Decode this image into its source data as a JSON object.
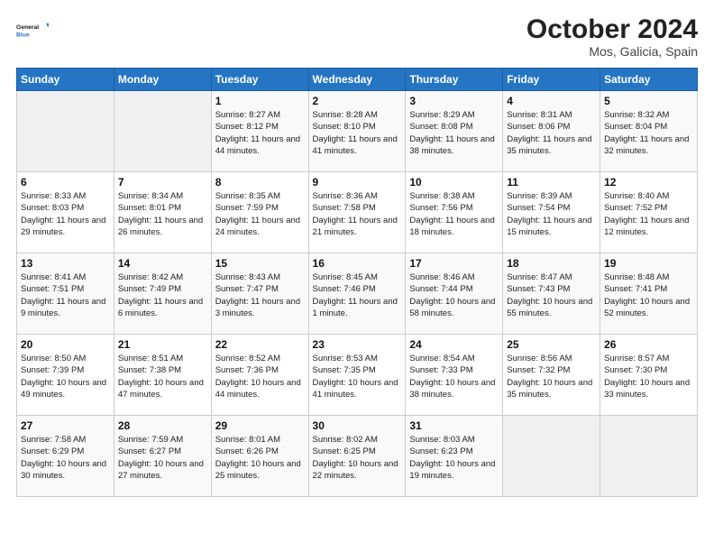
{
  "logo": {
    "line1": "General",
    "line2": "Blue"
  },
  "title": "October 2024",
  "subtitle": "Mos, Galicia, Spain",
  "days_of_week": [
    "Sunday",
    "Monday",
    "Tuesday",
    "Wednesday",
    "Thursday",
    "Friday",
    "Saturday"
  ],
  "weeks": [
    [
      {
        "num": "",
        "info": ""
      },
      {
        "num": "",
        "info": ""
      },
      {
        "num": "1",
        "info": "Sunrise: 8:27 AM\nSunset: 8:12 PM\nDaylight: 11 hours and 44 minutes."
      },
      {
        "num": "2",
        "info": "Sunrise: 8:28 AM\nSunset: 8:10 PM\nDaylight: 11 hours and 41 minutes."
      },
      {
        "num": "3",
        "info": "Sunrise: 8:29 AM\nSunset: 8:08 PM\nDaylight: 11 hours and 38 minutes."
      },
      {
        "num": "4",
        "info": "Sunrise: 8:31 AM\nSunset: 8:06 PM\nDaylight: 11 hours and 35 minutes."
      },
      {
        "num": "5",
        "info": "Sunrise: 8:32 AM\nSunset: 8:04 PM\nDaylight: 11 hours and 32 minutes."
      }
    ],
    [
      {
        "num": "6",
        "info": "Sunrise: 8:33 AM\nSunset: 8:03 PM\nDaylight: 11 hours and 29 minutes."
      },
      {
        "num": "7",
        "info": "Sunrise: 8:34 AM\nSunset: 8:01 PM\nDaylight: 11 hours and 26 minutes."
      },
      {
        "num": "8",
        "info": "Sunrise: 8:35 AM\nSunset: 7:59 PM\nDaylight: 11 hours and 24 minutes."
      },
      {
        "num": "9",
        "info": "Sunrise: 8:36 AM\nSunset: 7:58 PM\nDaylight: 11 hours and 21 minutes."
      },
      {
        "num": "10",
        "info": "Sunrise: 8:38 AM\nSunset: 7:56 PM\nDaylight: 11 hours and 18 minutes."
      },
      {
        "num": "11",
        "info": "Sunrise: 8:39 AM\nSunset: 7:54 PM\nDaylight: 11 hours and 15 minutes."
      },
      {
        "num": "12",
        "info": "Sunrise: 8:40 AM\nSunset: 7:52 PM\nDaylight: 11 hours and 12 minutes."
      }
    ],
    [
      {
        "num": "13",
        "info": "Sunrise: 8:41 AM\nSunset: 7:51 PM\nDaylight: 11 hours and 9 minutes."
      },
      {
        "num": "14",
        "info": "Sunrise: 8:42 AM\nSunset: 7:49 PM\nDaylight: 11 hours and 6 minutes."
      },
      {
        "num": "15",
        "info": "Sunrise: 8:43 AM\nSunset: 7:47 PM\nDaylight: 11 hours and 3 minutes."
      },
      {
        "num": "16",
        "info": "Sunrise: 8:45 AM\nSunset: 7:46 PM\nDaylight: 11 hours and 1 minute."
      },
      {
        "num": "17",
        "info": "Sunrise: 8:46 AM\nSunset: 7:44 PM\nDaylight: 10 hours and 58 minutes."
      },
      {
        "num": "18",
        "info": "Sunrise: 8:47 AM\nSunset: 7:43 PM\nDaylight: 10 hours and 55 minutes."
      },
      {
        "num": "19",
        "info": "Sunrise: 8:48 AM\nSunset: 7:41 PM\nDaylight: 10 hours and 52 minutes."
      }
    ],
    [
      {
        "num": "20",
        "info": "Sunrise: 8:50 AM\nSunset: 7:39 PM\nDaylight: 10 hours and 49 minutes."
      },
      {
        "num": "21",
        "info": "Sunrise: 8:51 AM\nSunset: 7:38 PM\nDaylight: 10 hours and 47 minutes."
      },
      {
        "num": "22",
        "info": "Sunrise: 8:52 AM\nSunset: 7:36 PM\nDaylight: 10 hours and 44 minutes."
      },
      {
        "num": "23",
        "info": "Sunrise: 8:53 AM\nSunset: 7:35 PM\nDaylight: 10 hours and 41 minutes."
      },
      {
        "num": "24",
        "info": "Sunrise: 8:54 AM\nSunset: 7:33 PM\nDaylight: 10 hours and 38 minutes."
      },
      {
        "num": "25",
        "info": "Sunrise: 8:56 AM\nSunset: 7:32 PM\nDaylight: 10 hours and 35 minutes."
      },
      {
        "num": "26",
        "info": "Sunrise: 8:57 AM\nSunset: 7:30 PM\nDaylight: 10 hours and 33 minutes."
      }
    ],
    [
      {
        "num": "27",
        "info": "Sunrise: 7:58 AM\nSunset: 6:29 PM\nDaylight: 10 hours and 30 minutes."
      },
      {
        "num": "28",
        "info": "Sunrise: 7:59 AM\nSunset: 6:27 PM\nDaylight: 10 hours and 27 minutes."
      },
      {
        "num": "29",
        "info": "Sunrise: 8:01 AM\nSunset: 6:26 PM\nDaylight: 10 hours and 25 minutes."
      },
      {
        "num": "30",
        "info": "Sunrise: 8:02 AM\nSunset: 6:25 PM\nDaylight: 10 hours and 22 minutes."
      },
      {
        "num": "31",
        "info": "Sunrise: 8:03 AM\nSunset: 6:23 PM\nDaylight: 10 hours and 19 minutes."
      },
      {
        "num": "",
        "info": ""
      },
      {
        "num": "",
        "info": ""
      }
    ]
  ]
}
